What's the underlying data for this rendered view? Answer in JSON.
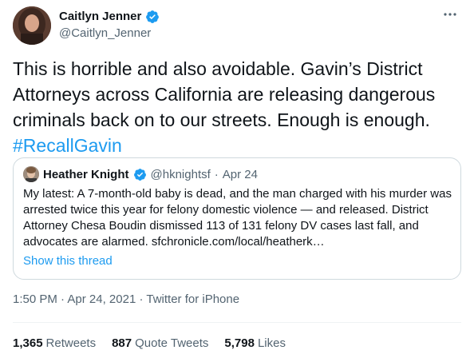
{
  "author": {
    "name": "Caitlyn Jenner",
    "handle": "@Caitlyn_Jenner"
  },
  "tweet": {
    "text": "This is horrible and also avoidable. Gavin’s District Attorneys across California are releasing dangerous criminals back on to our streets. Enough is enough. ",
    "hashtag": "#RecallGavin"
  },
  "quoted": {
    "name": "Heather Knight",
    "handle": "@hknightsf",
    "separator": "·",
    "date": "Apr 24",
    "text": "My latest: A 7-month-old baby is dead, and the man charged with his murder was arrested twice this year for felony domestic violence — and released. District Attorney Chesa Boudin dismissed 113 of 131 felony DV cases last fall, and advocates are alarmed. sfchronicle.com/local/heatherk…",
    "show_thread": "Show this thread"
  },
  "meta": {
    "time": "1:50 PM",
    "dot1": " · ",
    "date": "Apr 24, 2021",
    "dot2": " · ",
    "source": "Twitter for iPhone"
  },
  "stats": {
    "retweets_count": "1,365",
    "retweets_label": "Retweets",
    "quotes_count": "887",
    "quotes_label": "Quote Tweets",
    "likes_count": "5,798",
    "likes_label": "Likes"
  },
  "colors": {
    "accent": "#1d9bf0",
    "text": "#0f1419",
    "secondary": "#536471",
    "border": "#cfd9de"
  }
}
